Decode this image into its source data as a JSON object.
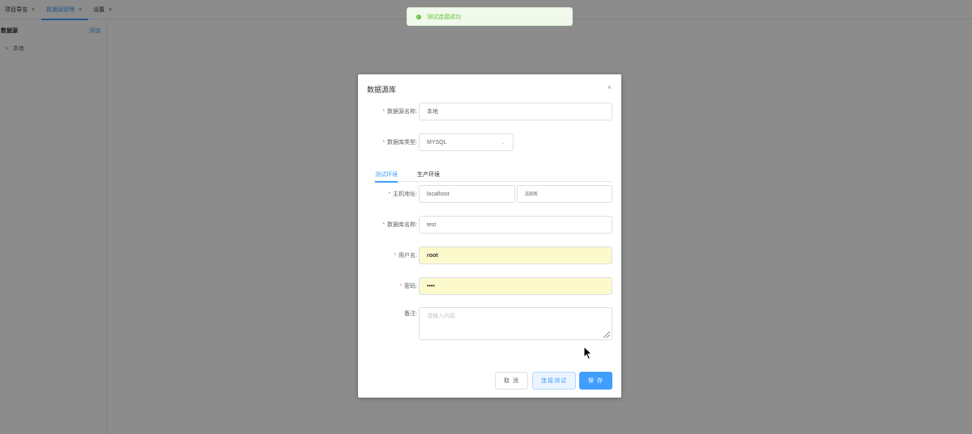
{
  "tabs": [
    {
      "label": "项目导览",
      "active": false
    },
    {
      "label": "数据源管理",
      "active": true
    },
    {
      "label": "设置",
      "active": false
    }
  ],
  "tab_close_glyph": "×",
  "sidebar": {
    "title": "数据源",
    "add_label": "添加",
    "items": [
      {
        "label": "本地"
      }
    ]
  },
  "toast": {
    "message": "测试连接成功",
    "icon": "check-circle-icon",
    "color": "#67c23a"
  },
  "dialog": {
    "title": "数据源库",
    "close_glyph": "×",
    "name": {
      "label": "数据源名称:",
      "value": "本地"
    },
    "db_type": {
      "label": "数据库类型:",
      "value": "MYSQL"
    },
    "env_tabs": [
      {
        "label": "测试环境",
        "active": true
      },
      {
        "label": "生产环境",
        "active": false
      }
    ],
    "host": {
      "label": "主机地址:",
      "host_value": "localhost",
      "port_value": "3306"
    },
    "database": {
      "label": "数据库名称:",
      "value": "test"
    },
    "username": {
      "label": "用户名:",
      "value": "root"
    },
    "password": {
      "label": "密码:",
      "value": "••••"
    },
    "remark": {
      "label": "备注:",
      "placeholder": "请输入内容"
    },
    "buttons": {
      "cancel": "取 消",
      "test": "连接测试",
      "save": "保 存"
    }
  },
  "colors": {
    "primary": "#409eff",
    "required": "#f56c6c",
    "success": "#67c23a",
    "autofill": "#fcf9cd"
  }
}
